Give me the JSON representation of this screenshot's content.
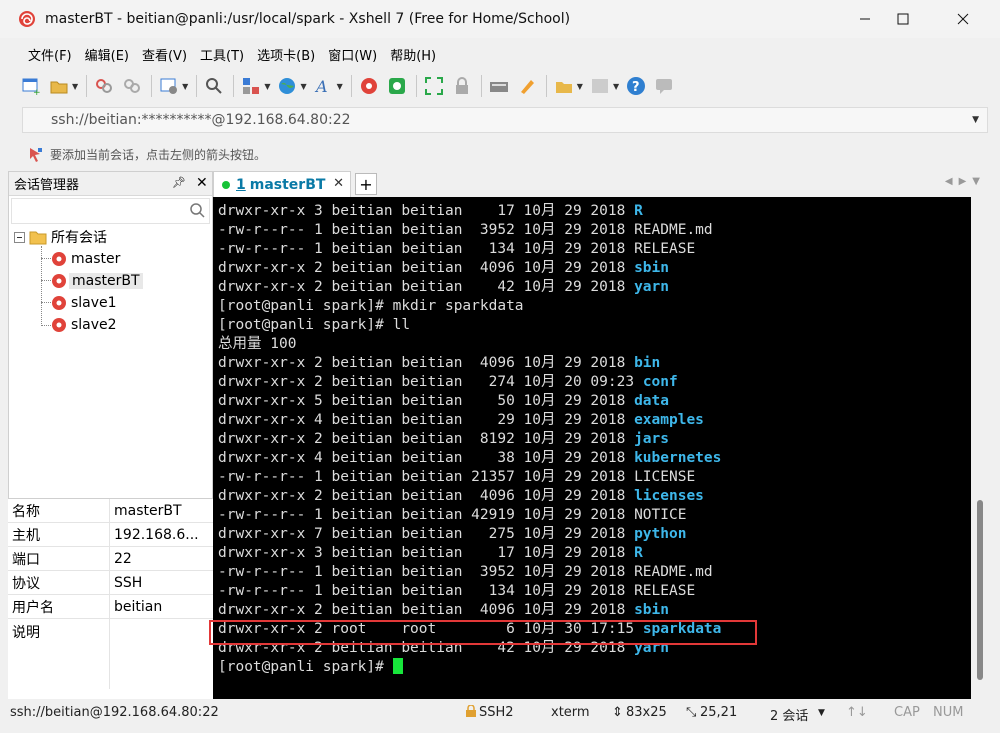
{
  "window": {
    "title": "masterBT - beitian@panli:/usr/local/spark - Xshell 7 (Free for Home/School)"
  },
  "menu": [
    "文件(F)",
    "编辑(E)",
    "查看(V)",
    "工具(T)",
    "选项卡(B)",
    "窗口(W)",
    "帮助(H)"
  ],
  "address": {
    "value": "ssh://beitian:**********@192.168.64.80:22"
  },
  "hint": {
    "text": "要添加当前会话，点击左侧的箭头按钮。"
  },
  "session_manager": {
    "title": "会话管理器",
    "root": "所有会话",
    "sessions": [
      "master",
      "masterBT",
      "slave1",
      "slave2"
    ],
    "selected": "masterBT"
  },
  "properties": [
    {
      "key": "名称",
      "value": "masterBT"
    },
    {
      "key": "主机",
      "value": "192.168.6..."
    },
    {
      "key": "端口",
      "value": "22"
    },
    {
      "key": "协议",
      "value": "SSH"
    },
    {
      "key": "用户名",
      "value": "beitian"
    },
    {
      "key": "说明",
      "value": ""
    }
  ],
  "tab": {
    "index": "1",
    "label": "masterBT"
  },
  "terminal": {
    "lines": [
      {
        "t": "drwxr-xr-x 3 beitian beitian    17 10月 29 2018 ",
        "n": "R"
      },
      {
        "t": "-rw-r--r-- 1 beitian beitian  3952 10月 29 2018 README.md",
        "n": ""
      },
      {
        "t": "-rw-r--r-- 1 beitian beitian   134 10月 29 2018 RELEASE",
        "n": ""
      },
      {
        "t": "drwxr-xr-x 2 beitian beitian  4096 10月 29 2018 ",
        "n": "sbin"
      },
      {
        "t": "drwxr-xr-x 2 beitian beitian    42 10月 29 2018 ",
        "n": "yarn"
      },
      {
        "t": "[root@panli spark]# mkdir sparkdata",
        "n": ""
      },
      {
        "t": "[root@panli spark]# ll",
        "n": ""
      },
      {
        "t": "总用量 100",
        "n": ""
      },
      {
        "t": "drwxr-xr-x 2 beitian beitian  4096 10月 29 2018 ",
        "n": "bin"
      },
      {
        "t": "drwxr-xr-x 2 beitian beitian   274 10月 20 09:23 ",
        "n": "conf"
      },
      {
        "t": "drwxr-xr-x 5 beitian beitian    50 10月 29 2018 ",
        "n": "data"
      },
      {
        "t": "drwxr-xr-x 4 beitian beitian    29 10月 29 2018 ",
        "n": "examples"
      },
      {
        "t": "drwxr-xr-x 2 beitian beitian  8192 10月 29 2018 ",
        "n": "jars"
      },
      {
        "t": "drwxr-xr-x 4 beitian beitian    38 10月 29 2018 ",
        "n": "kubernetes"
      },
      {
        "t": "-rw-r--r-- 1 beitian beitian 21357 10月 29 2018 LICENSE",
        "n": ""
      },
      {
        "t": "drwxr-xr-x 2 beitian beitian  4096 10月 29 2018 ",
        "n": "licenses"
      },
      {
        "t": "-rw-r--r-- 1 beitian beitian 42919 10月 29 2018 NOTICE",
        "n": ""
      },
      {
        "t": "drwxr-xr-x 7 beitian beitian   275 10月 29 2018 ",
        "n": "python"
      },
      {
        "t": "drwxr-xr-x 3 beitian beitian    17 10月 29 2018 ",
        "n": "R"
      },
      {
        "t": "-rw-r--r-- 1 beitian beitian  3952 10月 29 2018 README.md",
        "n": ""
      },
      {
        "t": "-rw-r--r-- 1 beitian beitian   134 10月 29 2018 RELEASE",
        "n": ""
      },
      {
        "t": "drwxr-xr-x 2 beitian beitian  4096 10月 29 2018 ",
        "n": "sbin"
      },
      {
        "t": "drwxr-xr-x 2 root    root        6 10月 30 17:15 ",
        "n": "sparkdata"
      },
      {
        "t": "drwxr-xr-x 2 beitian beitian    42 10月 29 2018 ",
        "n": "yarn"
      },
      {
        "t": "[root@panli spark]# ",
        "n": ""
      }
    ]
  },
  "status": {
    "connection": "ssh://beitian@192.168.64.80:22",
    "protocol": "SSH2",
    "term": "xterm",
    "size": "83x25",
    "cursor_pos": "25,21",
    "sessions": "2 会话",
    "caps": "CAP",
    "num": "NUM"
  },
  "colors": {
    "dir": "#3eb7ea",
    "cursor": "#17e63b",
    "highlight": "#e23838",
    "tab_text": "#0a7aa6"
  }
}
